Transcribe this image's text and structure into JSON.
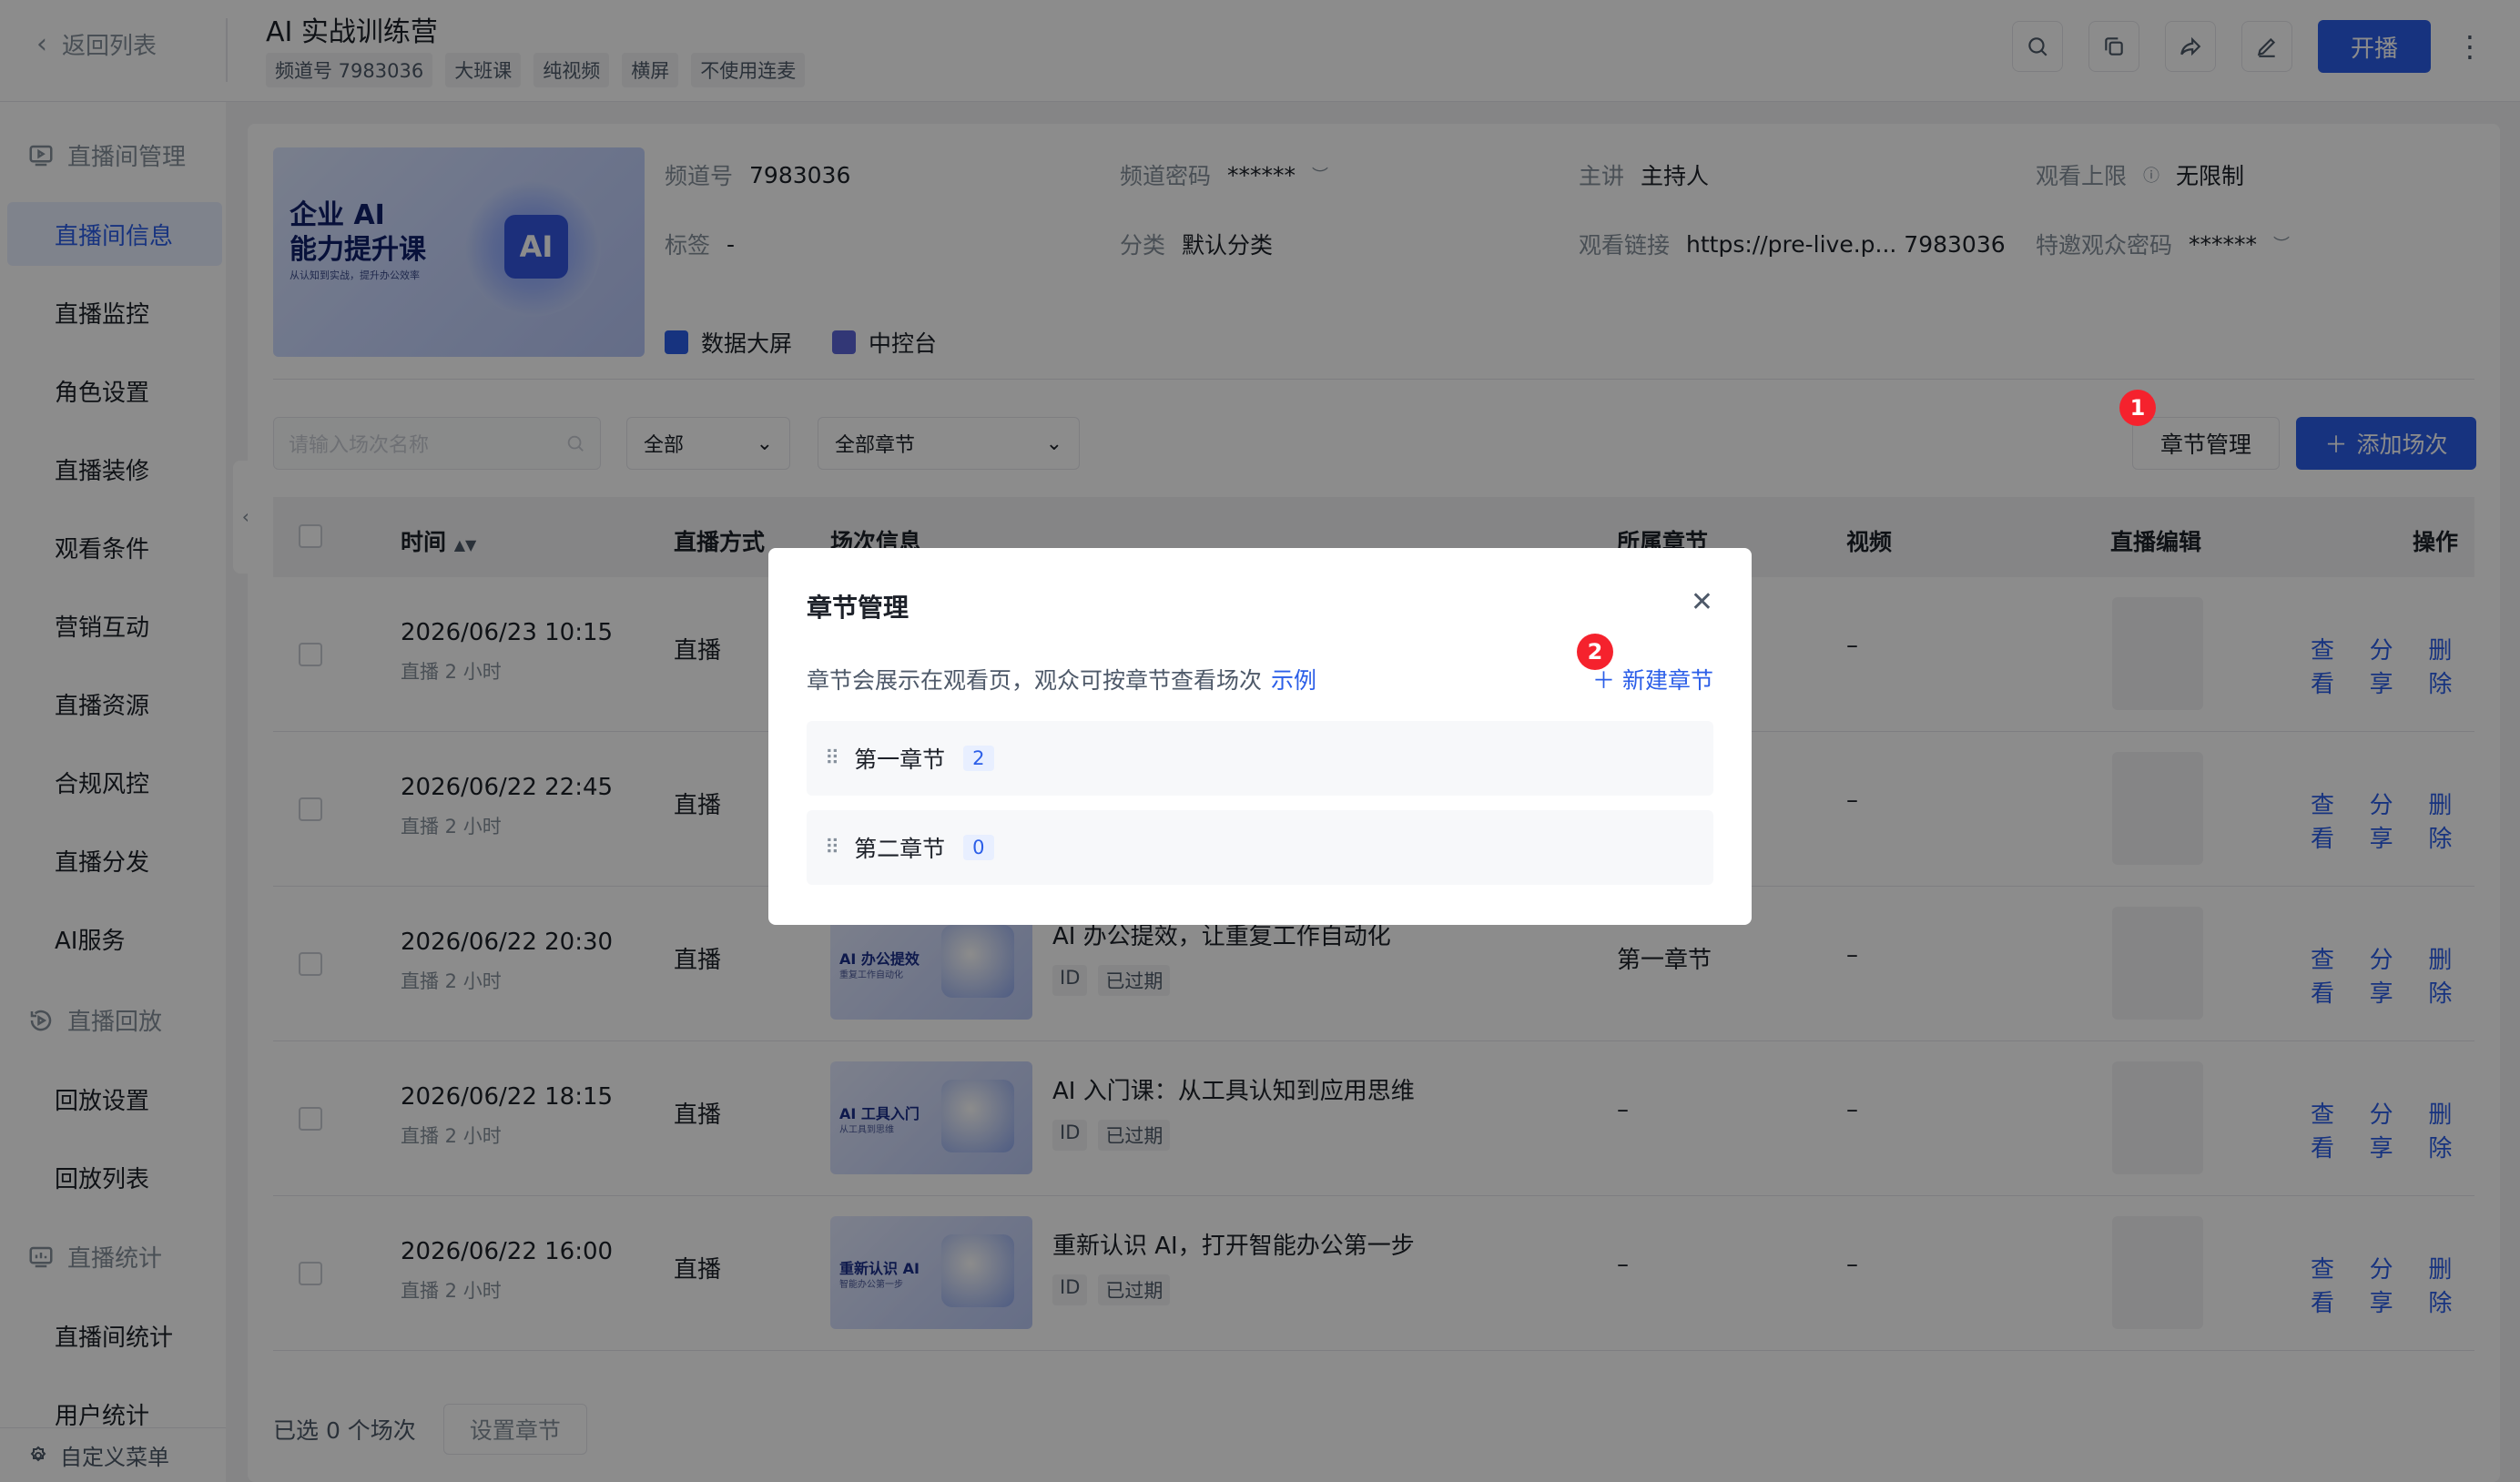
{
  "header": {
    "back_label": "返回列表",
    "title": "AI 实战训练营",
    "tags": [
      "频道号 7983036",
      "大班课",
      "纯视频",
      "横屏",
      "不使用连麦"
    ],
    "start_label": "开播"
  },
  "sidebar": {
    "groups": [
      {
        "label": "直播间管理",
        "icon": "live-room-icon"
      },
      {
        "label": "直播回放",
        "icon": "replay-icon"
      },
      {
        "label": "直播统计",
        "icon": "stats-icon"
      }
    ],
    "items": [
      "直播间信息",
      "直播监控",
      "角色设置",
      "直播装修",
      "观看条件",
      "营销互动",
      "直播资源",
      "合规风控",
      "直播分发",
      "AI服务",
      "回放设置",
      "回放列表",
      "直播间统计",
      "用户统计"
    ],
    "footer_label": "自定义菜单"
  },
  "cover": {
    "line1": "企业 AI",
    "line2": "能力提升课",
    "sub": "从认知到实战，提升办公效率",
    "badge": "AI"
  },
  "info": {
    "channel_k": "频道号",
    "channel_v": "7983036",
    "pwd_k": "频道密码",
    "pwd_v": "******",
    "host_k": "主讲",
    "host_v": "主持人",
    "limit_k": "观看上限",
    "limit_v": "无限制",
    "tag_k": "标签",
    "tag_v": "-",
    "cat_k": "分类",
    "cat_v": "默认分类",
    "link_k": "观看链接",
    "link_v": "https://pre-live.p... 7983036",
    "invite_k": "特邀观众密码",
    "invite_v": "******",
    "quick1": "数据大屏",
    "quick2": "中控台"
  },
  "filters": {
    "search_placeholder": "请输入场次名称",
    "status": "全部",
    "chapter": "全部章节",
    "chapter_manage": "章节管理",
    "add_session": "添加场次",
    "badge1": "1",
    "badge2": "2"
  },
  "table": {
    "headers": {
      "time": "时间",
      "mode": "直播方式",
      "info": "场次信息",
      "chapter": "所属章节",
      "video": "视频",
      "edit": "直播编辑",
      "ops": "操作"
    },
    "ops": {
      "view": "查看",
      "share": "分享",
      "delete": "删除"
    },
    "rows": [
      {
        "time": "2026/06/23 10:15",
        "dur": "直播 2 小时",
        "mode": "直播",
        "title": "",
        "thumb_title": "",
        "thumb_sub": "",
        "tag_id": "",
        "tag_status": "",
        "chapter": "",
        "video": "–"
      },
      {
        "time": "2026/06/22 22:45",
        "dur": "直播 2 小时",
        "mode": "直播",
        "title": "",
        "thumb_title": "",
        "thumb_sub": "",
        "tag_id": "",
        "tag_status": "",
        "chapter": "",
        "video": "–"
      },
      {
        "time": "2026/06/22 20:30",
        "dur": "直播 2 小时",
        "mode": "直播",
        "title": "AI 办公提效，让重复工作自动化",
        "thumb_title": "AI 办公提效",
        "thumb_sub": "重复工作自动化",
        "tag_id": "ID",
        "tag_status": "已过期",
        "chapter": "第一章节",
        "video": "–"
      },
      {
        "time": "2026/06/22 18:15",
        "dur": "直播 2 小时",
        "mode": "直播",
        "title": "AI 入门课：从工具认知到应用思维",
        "thumb_title": "AI 工具入门",
        "thumb_sub": "从工具到思维",
        "tag_id": "ID",
        "tag_status": "已过期",
        "chapter": "–",
        "video": "–"
      },
      {
        "time": "2026/06/22 16:00",
        "dur": "直播 2 小时",
        "mode": "直播",
        "title": "重新认识 AI，打开智能办公第一步",
        "thumb_title": "重新认识 AI",
        "thumb_sub": "智能办公第一步",
        "tag_id": "ID",
        "tag_status": "已过期",
        "chapter": "–",
        "video": "–"
      }
    ]
  },
  "bottom": {
    "selected": "已选 0 个场次",
    "set_chapter": "设置章节"
  },
  "modal": {
    "title": "章节管理",
    "desc": "章节会展示在观看页，观众可按章节查看场次",
    "example": "示例",
    "new_chapter": "新建章节",
    "chapters": [
      {
        "name": "第一章节",
        "count": "2"
      },
      {
        "name": "第二章节",
        "count": "0"
      }
    ]
  },
  "colors": {
    "primary": "#2b5ee8",
    "badge": "#f5222d"
  }
}
